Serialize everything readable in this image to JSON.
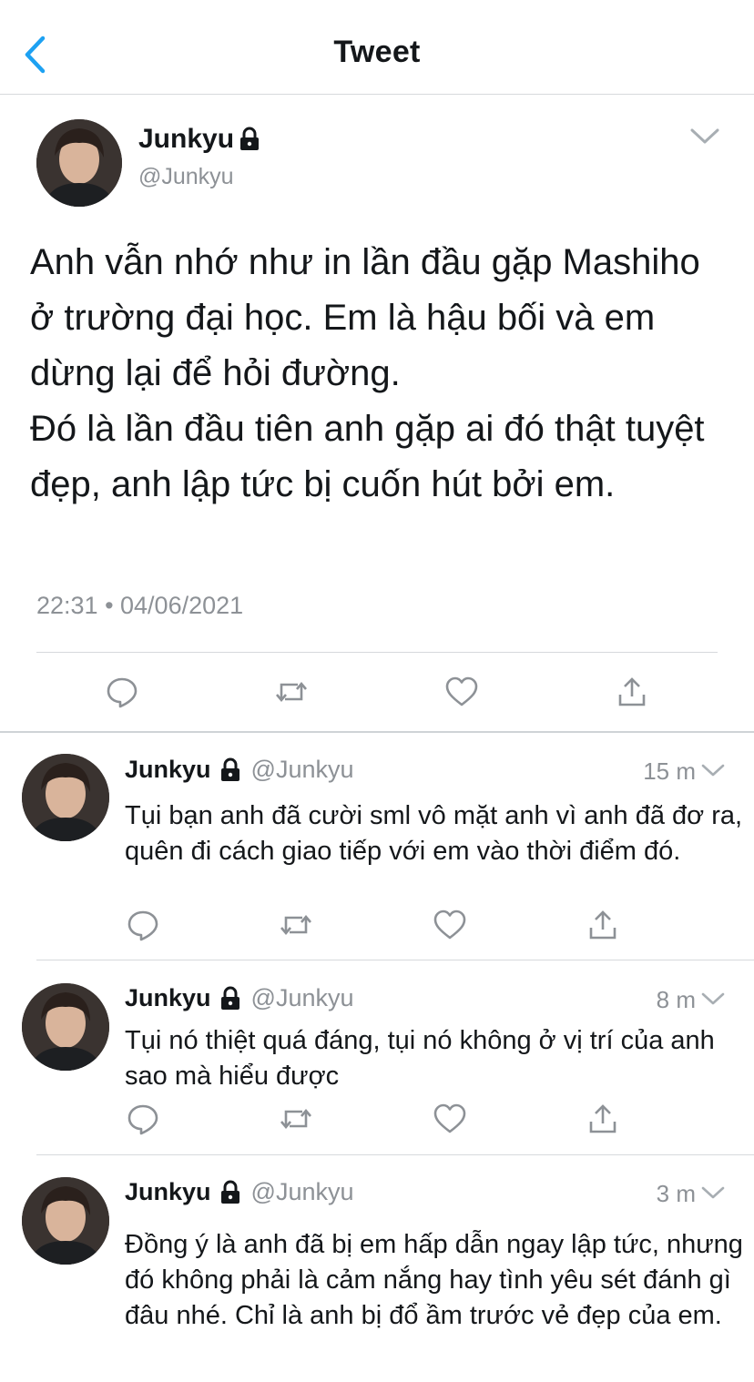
{
  "header": {
    "title": "Tweet",
    "back_icon": "chevron-left-icon"
  },
  "colors": {
    "accent": "#1da1f2",
    "text": "#14171a",
    "muted": "#8d9196",
    "divider": "#d6d9dc"
  },
  "main_tweet": {
    "name": "Junkyu",
    "handle": "@Junkyu",
    "protected_icon": "lock-icon",
    "paragraphs": [
      "Anh vẫn nhớ như in lần đầu gặp Mashiho ở trường đại học. Em là hậu bối và em dừng lại để hỏi đường.",
      "Đó là lần đầu tiên anh gặp ai đó thật tuyệt đẹp, anh lập tức bị cuốn hút bởi em."
    ],
    "timestamp": "22:31 • 04/06/2021",
    "actions": [
      "reply-icon",
      "retweet-icon",
      "like-icon",
      "share-icon"
    ]
  },
  "replies": [
    {
      "name": "Junkyu",
      "handle": "@Junkyu",
      "time": "15 m",
      "text": "Tụi bạn anh đã cười sml vô mặt anh vì anh đã đơ ra, quên đi cách giao tiếp với em vào thời điểm đó."
    },
    {
      "name": "Junkyu",
      "handle": "@Junkyu",
      "time": "8 m",
      "text": "Tụi nó thiệt quá đáng, tụi nó không ở vị trí của anh sao mà hiểu được"
    },
    {
      "name": "Junkyu",
      "handle": "@Junkyu",
      "time": "3 m",
      "text": "Đồng ý là anh đã bị em hấp dẫn ngay lập tức, nhưng đó không phải là cảm nắng hay tình yêu sét đánh gì đâu nhé. Chỉ là anh bị đổ ầm trước vẻ đẹp của em."
    }
  ]
}
